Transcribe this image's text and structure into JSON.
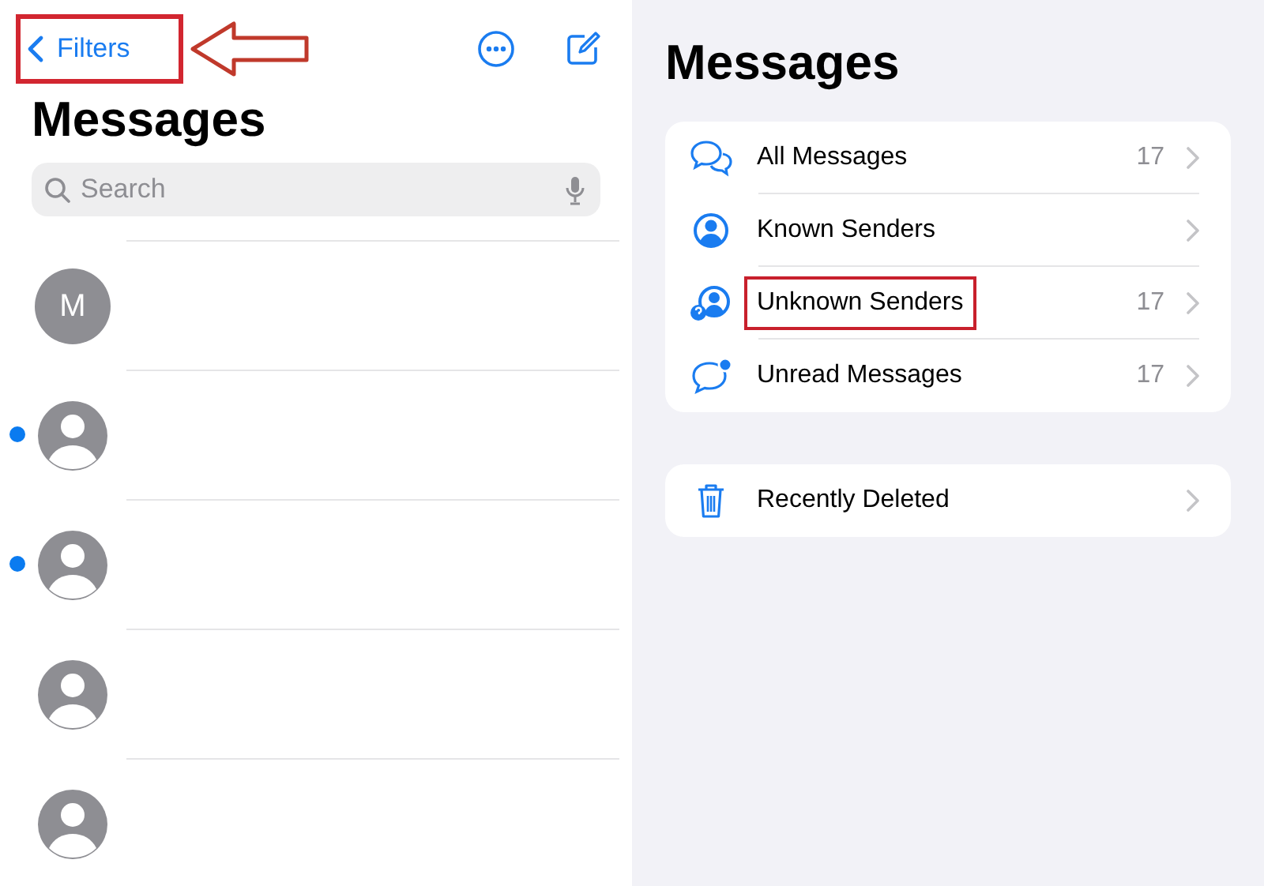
{
  "left": {
    "back": {
      "label": "Filters",
      "highlighted": true
    },
    "title": "Messages",
    "search": {
      "placeholder": "Search"
    },
    "conversations": [
      {
        "avatar": {
          "kind": "initial",
          "text": "M"
        },
        "unread": false
      },
      {
        "avatar": {
          "kind": "person"
        },
        "unread": true
      },
      {
        "avatar": {
          "kind": "person"
        },
        "unread": true
      },
      {
        "avatar": {
          "kind": "person"
        },
        "unread": false
      },
      {
        "avatar": {
          "kind": "person"
        },
        "unread": false
      }
    ]
  },
  "right": {
    "title": "Messages",
    "groups": [
      [
        {
          "kind": "all",
          "label": "All Messages",
          "count": "17",
          "highlighted": false
        },
        {
          "kind": "known",
          "label": "Known Senders",
          "highlighted": false
        },
        {
          "kind": "unknown",
          "label": "Unknown Senders",
          "count": "17",
          "highlighted": true
        },
        {
          "kind": "unread",
          "label": "Unread Messages",
          "count": "17",
          "highlighted": false
        }
      ],
      [
        {
          "kind": "deleted",
          "label": "Recently Deleted",
          "highlighted": false
        }
      ]
    ]
  }
}
